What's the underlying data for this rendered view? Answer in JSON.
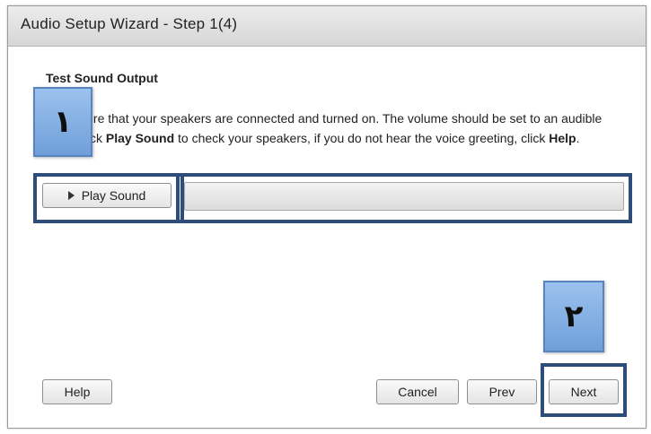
{
  "window": {
    "title": "Audio Setup Wizard - Step 1(4)"
  },
  "content": {
    "heading": "Test Sound Output",
    "instructions_parts": [
      "Make sure that your speakers are connected and turned on. The volume should be set to an audible level.Click ",
      "Play Sound",
      " to check your speakers, if you do not hear the voice greeting, click ",
      "Help",
      "."
    ]
  },
  "controls": {
    "play_sound_label": "Play Sound",
    "progress": 0
  },
  "footer": {
    "help_label": "Help",
    "cancel_label": "Cancel",
    "prev_label": "Prev",
    "next_label": "Next"
  },
  "annotations": {
    "badge_1": "١",
    "badge_2": "٢",
    "highlight_color": "#2f4d7a",
    "badge_color": "#8bb6ea"
  }
}
